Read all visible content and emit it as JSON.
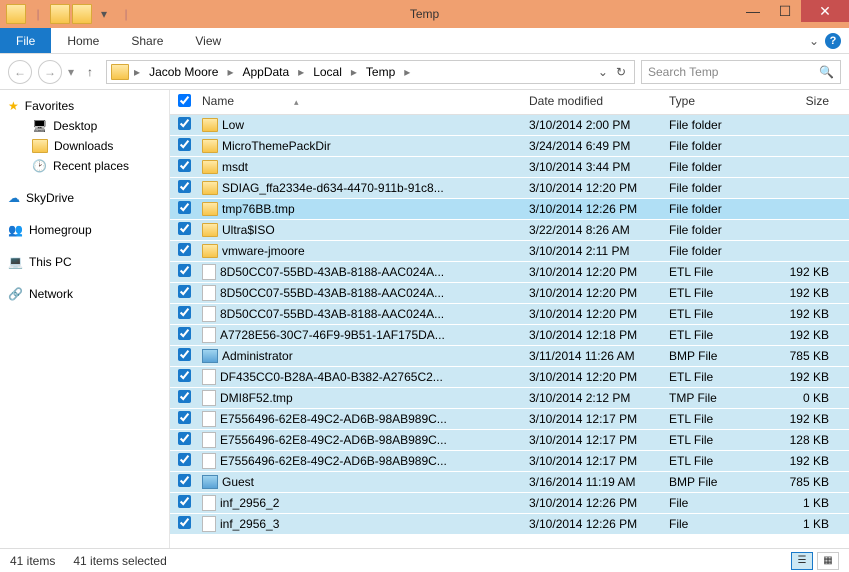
{
  "window": {
    "title": "Temp"
  },
  "ribbon": {
    "file": "File",
    "tabs": [
      "Home",
      "Share",
      "View"
    ]
  },
  "breadcrumb": [
    "Jacob Moore",
    "AppData",
    "Local",
    "Temp"
  ],
  "search": {
    "placeholder": "Search Temp"
  },
  "sidebar": {
    "favorites": {
      "label": "Favorites",
      "items": [
        "Desktop",
        "Downloads",
        "Recent places"
      ]
    },
    "skydrive": "SkyDrive",
    "homegroup": "Homegroup",
    "thispc": "This PC",
    "network": "Network"
  },
  "columns": {
    "name": "Name",
    "date": "Date modified",
    "type": "Type",
    "size": "Size"
  },
  "files": [
    {
      "icon": "folder",
      "name": "Low",
      "date": "3/10/2014 2:00 PM",
      "type": "File folder",
      "size": ""
    },
    {
      "icon": "folder",
      "name": "MicroThemePackDir",
      "date": "3/24/2014 6:49 PM",
      "type": "File folder",
      "size": ""
    },
    {
      "icon": "folder",
      "name": "msdt",
      "date": "3/10/2014 3:44 PM",
      "type": "File folder",
      "size": ""
    },
    {
      "icon": "folder",
      "name": "SDIAG_ffa2334e-d634-4470-911b-91c8...",
      "date": "3/10/2014 12:20 PM",
      "type": "File folder",
      "size": ""
    },
    {
      "icon": "folder",
      "name": "tmp76BB.tmp",
      "date": "3/10/2014 12:26 PM",
      "type": "File folder",
      "size": "",
      "hl": true
    },
    {
      "icon": "folder",
      "name": "Ultra$ISO",
      "date": "3/22/2014 8:26 AM",
      "type": "File folder",
      "size": ""
    },
    {
      "icon": "folder",
      "name": "vmware-jmoore",
      "date": "3/10/2014 2:11 PM",
      "type": "File folder",
      "size": ""
    },
    {
      "icon": "file",
      "name": "8D50CC07-55BD-43AB-8188-AAC024A...",
      "date": "3/10/2014 12:20 PM",
      "type": "ETL File",
      "size": "192 KB"
    },
    {
      "icon": "file",
      "name": "8D50CC07-55BD-43AB-8188-AAC024A...",
      "date": "3/10/2014 12:20 PM",
      "type": "ETL File",
      "size": "192 KB"
    },
    {
      "icon": "file",
      "name": "8D50CC07-55BD-43AB-8188-AAC024A...",
      "date": "3/10/2014 12:20 PM",
      "type": "ETL File",
      "size": "192 KB"
    },
    {
      "icon": "file",
      "name": "A7728E56-30C7-46F9-9B51-1AF175DA...",
      "date": "3/10/2014 12:18 PM",
      "type": "ETL File",
      "size": "192 KB"
    },
    {
      "icon": "bmp",
      "name": "Administrator",
      "date": "3/11/2014 11:26 AM",
      "type": "BMP File",
      "size": "785 KB"
    },
    {
      "icon": "file",
      "name": "DF435CC0-B28A-4BA0-B382-A2765C2...",
      "date": "3/10/2014 12:20 PM",
      "type": "ETL File",
      "size": "192 KB"
    },
    {
      "icon": "file",
      "name": "DMI8F52.tmp",
      "date": "3/10/2014 2:12 PM",
      "type": "TMP File",
      "size": "0 KB"
    },
    {
      "icon": "file",
      "name": "E7556496-62E8-49C2-AD6B-98AB989C...",
      "date": "3/10/2014 12:17 PM",
      "type": "ETL File",
      "size": "192 KB"
    },
    {
      "icon": "file",
      "name": "E7556496-62E8-49C2-AD6B-98AB989C...",
      "date": "3/10/2014 12:17 PM",
      "type": "ETL File",
      "size": "128 KB"
    },
    {
      "icon": "file",
      "name": "E7556496-62E8-49C2-AD6B-98AB989C...",
      "date": "3/10/2014 12:17 PM",
      "type": "ETL File",
      "size": "192 KB"
    },
    {
      "icon": "bmp",
      "name": "Guest",
      "date": "3/16/2014 11:19 AM",
      "type": "BMP File",
      "size": "785 KB"
    },
    {
      "icon": "file",
      "name": "inf_2956_2",
      "date": "3/10/2014 12:26 PM",
      "type": "File",
      "size": "1 KB"
    },
    {
      "icon": "file",
      "name": "inf_2956_3",
      "date": "3/10/2014 12:26 PM",
      "type": "File",
      "size": "1 KB"
    }
  ],
  "status": {
    "count": "41 items",
    "selected": "41 items selected"
  }
}
